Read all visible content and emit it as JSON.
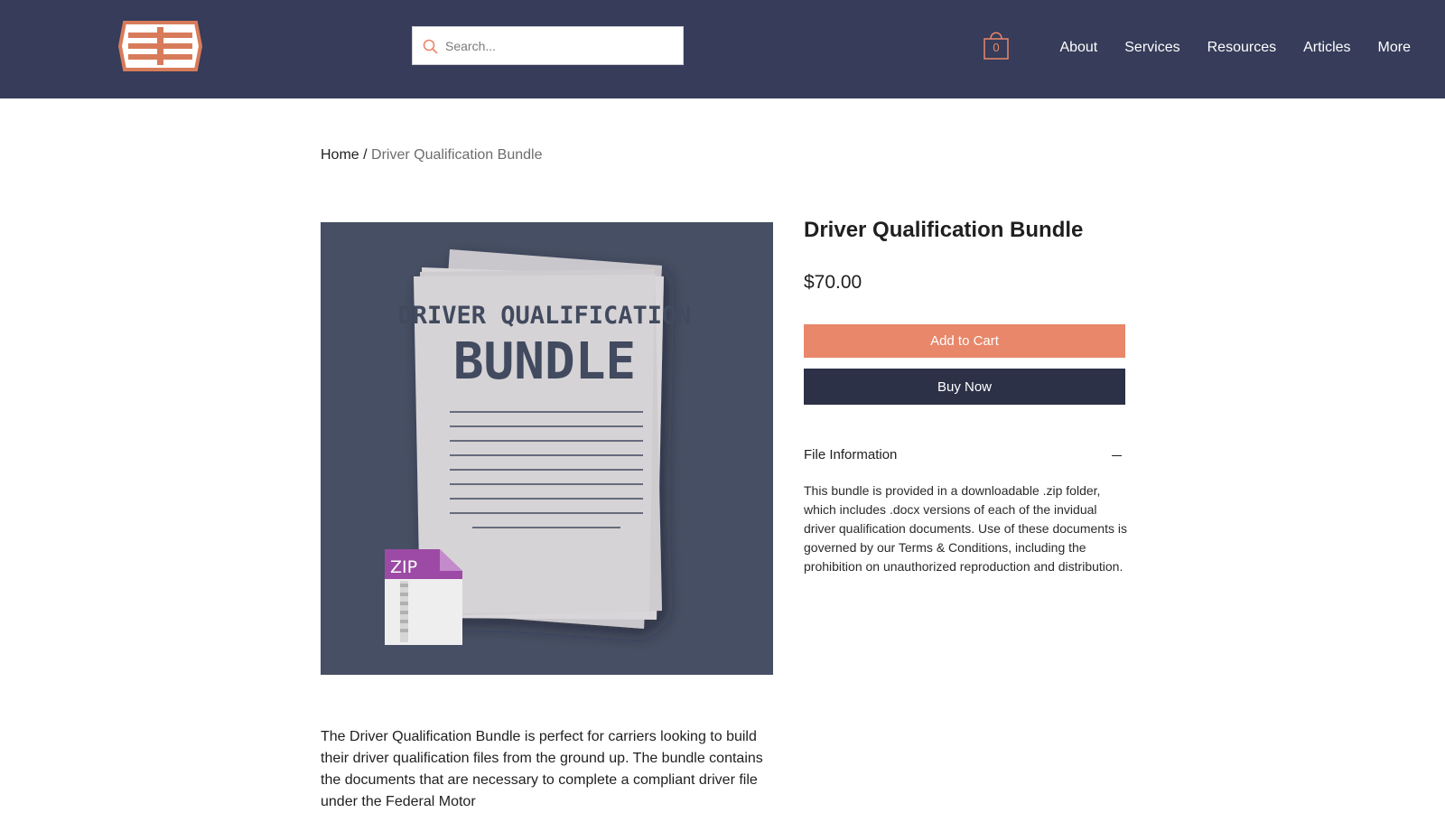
{
  "header": {
    "logo_icon": "stacked-bars-logo",
    "search": {
      "placeholder": "Search...",
      "value": "",
      "icon": "search-icon"
    },
    "cart": {
      "icon": "shopping-bag-icon",
      "count": "0"
    },
    "nav": [
      "About",
      "Services",
      "Resources",
      "Articles",
      "More"
    ]
  },
  "breadcrumb": {
    "home": "Home",
    "separator": "/",
    "current": "Driver Qualification Bundle"
  },
  "product": {
    "image": {
      "title_line1": "DRIVER QUALIFICATION",
      "title_line2": "BUNDLE",
      "zip_label": "ZIP",
      "icon": "zip-file-icon"
    },
    "title": "Driver Qualification Bundle",
    "price": "$70.00",
    "add_to_cart": "Add to Cart",
    "buy_now": "Buy Now",
    "info_section": {
      "label": "File Information",
      "toggle_icon": "minus-icon",
      "body": "This bundle is provided in a downloadable .zip folder, which includes .docx versions of each of the invidual driver qualification documents. Use of these documents is governed by our Terms & Conditions, including the prohibition on unauthorized reproduction and distribution."
    },
    "description": "The Driver Qualification Bundle is perfect for carriers looking to build their driver qualification files from the ground up. The bundle contains the documents that are necessary to complete a compliant driver file under the Federal Motor"
  },
  "colors": {
    "header_bg": "#363c59",
    "accent": "#e8876a",
    "buy_button": "#2c3147",
    "image_bg": "#464f63"
  }
}
